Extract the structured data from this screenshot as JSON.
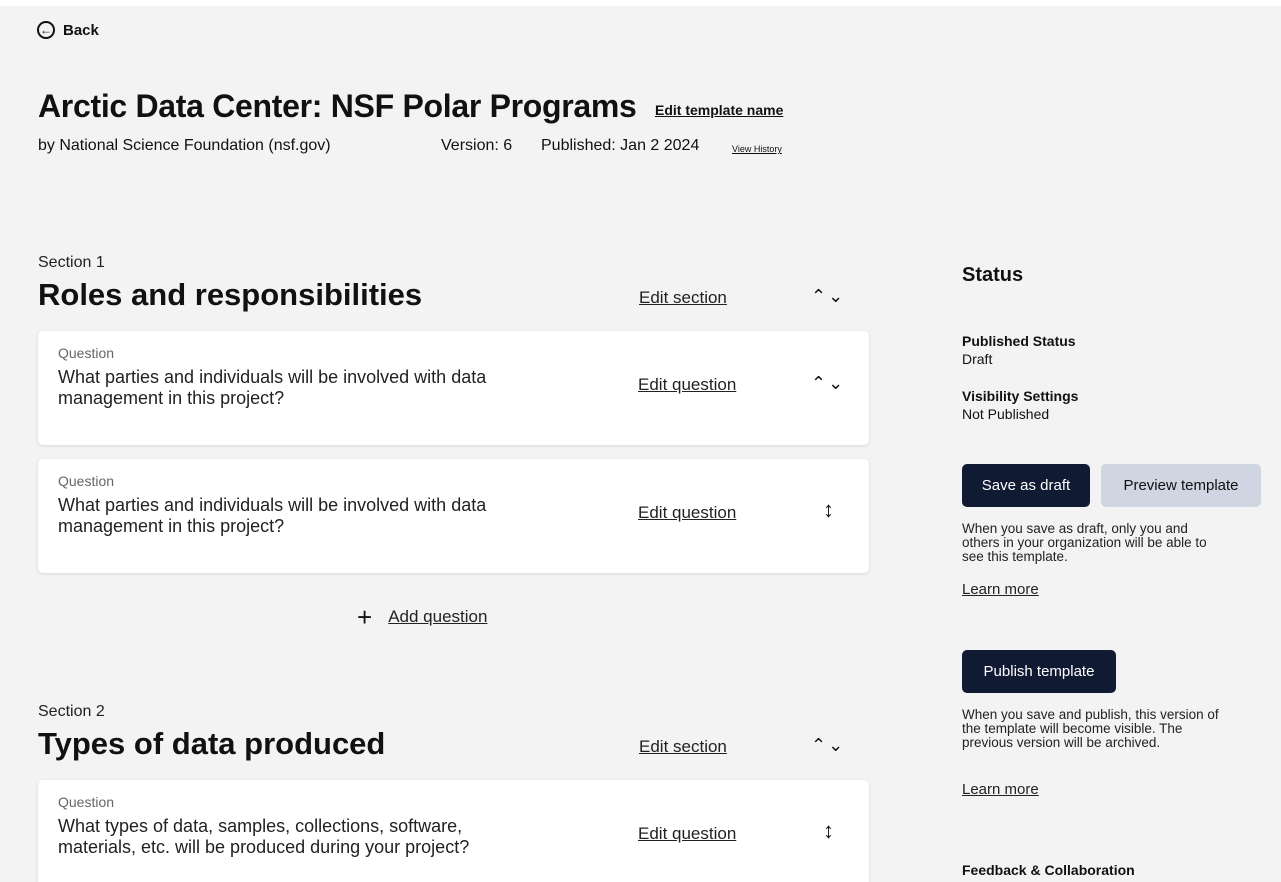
{
  "nav": {
    "back_label": "Back"
  },
  "header": {
    "title": "Arctic Data Center: NSF Polar Programs",
    "edit_name_label": "Edit template name",
    "organization": "by National Science Foundation (nsf.gov)",
    "version": "Version: 6",
    "published": "Published: Jan 2 2024",
    "history_label": "View History"
  },
  "sections": [
    {
      "label": "Section 1",
      "title": "Roles and responsibilities",
      "edit_label": "Edit section",
      "questions": [
        {
          "label": "Question",
          "text": "What parties and individuals will be involved with data management in this project?",
          "edit_label": "Edit question"
        },
        {
          "label": "Question",
          "text": "What parties and individuals will be involved with data management in this project?",
          "edit_label": "Edit question"
        }
      ],
      "add_question_label": "Add question"
    },
    {
      "label": "Section 2",
      "title": "Types of data produced",
      "edit_label": "Edit section",
      "questions": [
        {
          "label": "Question",
          "text": "What types of data, samples, collections, software, materials, etc. will be produced during your project?",
          "edit_label": "Edit question"
        }
      ]
    }
  ],
  "sidebar": {
    "status_heading": "Status",
    "published_status_label": "Published Status",
    "published_status_value": "Draft",
    "visibility_label": "Visibility Settings",
    "visibility_value": "Not Published",
    "save_draft_label": "Save as draft",
    "preview_label": "Preview template",
    "draft_note": "When you save as draft, only you and others in your organization will be able to see this template.",
    "learn_more_1": "Learn more",
    "publish_label": "Publish template",
    "publish_note": "When you save and publish, this version of the template will become visible. The previous version will be archived.",
    "learn_more_2": "Learn more",
    "feedback_heading": "Feedback & Collaboration"
  },
  "icons": {
    "back": "back-arrow-circle-icon",
    "move_up": "chevron-up-icon",
    "move_down": "chevron-down-icon",
    "reorder": "vertical-arrows-icon",
    "add": "plus-icon"
  },
  "colors": {
    "primary_button": "#101a33",
    "secondary_button": "#cfd6e2",
    "background": "#f3f3f3"
  }
}
